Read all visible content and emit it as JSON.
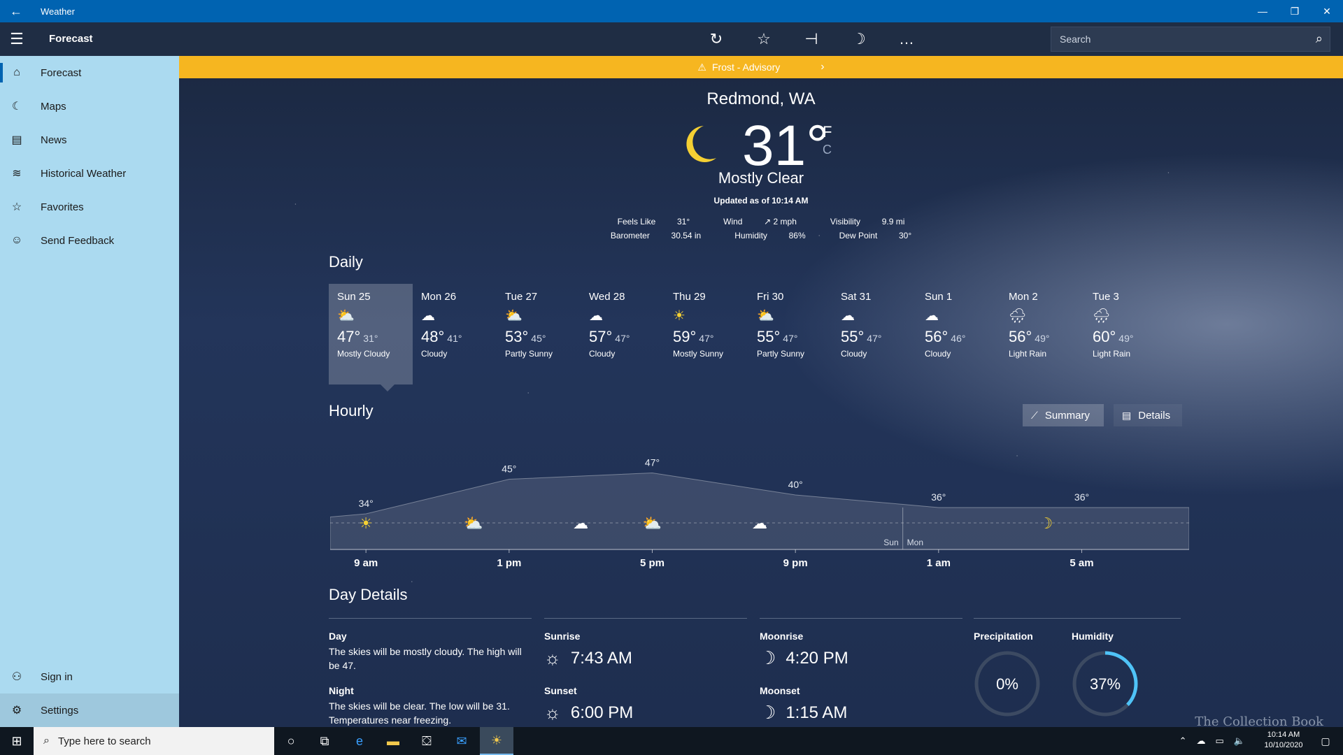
{
  "window": {
    "title": "Weather",
    "back": "←",
    "minimize": "—",
    "restore": "❐",
    "close": "✕"
  },
  "header": {
    "page_title": "Forecast",
    "search_placeholder": "Search"
  },
  "sidebar": {
    "items": [
      {
        "label": "Forecast",
        "icon": "⌂"
      },
      {
        "label": "Maps",
        "icon": "☾"
      },
      {
        "label": "News",
        "icon": "▤"
      },
      {
        "label": "Historical Weather",
        "icon": "≋"
      },
      {
        "label": "Favorites",
        "icon": "☆"
      },
      {
        "label": "Send Feedback",
        "icon": "☺"
      }
    ],
    "bottom": [
      {
        "label": "Sign in",
        "icon": "⚇"
      },
      {
        "label": "Settings",
        "icon": "⚙"
      }
    ]
  },
  "advisory": {
    "text": "Frost - Advisory"
  },
  "current": {
    "city": "Redmond, WA",
    "temp": "31°",
    "unit_f": "F",
    "unit_c": "C",
    "condition": "Mostly Clear",
    "updated": "Updated as of 10:14 AM",
    "feels_like_label": "Feels Like",
    "feels_like": "31°",
    "wind_label": "Wind",
    "wind": "↗ 2 mph",
    "visibility_label": "Visibility",
    "visibility": "9.9 mi",
    "barometer_label": "Barometer",
    "barometer": "30.54 in",
    "humidity_label": "Humidity",
    "humidity": "86%",
    "dewpoint_label": "Dew Point",
    "dewpoint": "30°"
  },
  "daily": {
    "title": "Daily",
    "days": [
      {
        "name": "Sun 25",
        "high": "47°",
        "low": "31°",
        "cond": "Mostly Cloudy",
        "icon": "partly"
      },
      {
        "name": "Mon 26",
        "high": "48°",
        "low": "41°",
        "cond": "Cloudy",
        "icon": "cloud"
      },
      {
        "name": "Tue 27",
        "high": "53°",
        "low": "45°",
        "cond": "Partly Sunny",
        "icon": "partly"
      },
      {
        "name": "Wed 28",
        "high": "57°",
        "low": "47°",
        "cond": "Cloudy",
        "icon": "cloud"
      },
      {
        "name": "Thu 29",
        "high": "59°",
        "low": "47°",
        "cond": "Mostly Sunny",
        "icon": "sun"
      },
      {
        "name": "Fri 30",
        "high": "55°",
        "low": "47°",
        "cond": "Partly Sunny",
        "icon": "partly"
      },
      {
        "name": "Sat 31",
        "high": "55°",
        "low": "47°",
        "cond": "Cloudy",
        "icon": "cloud"
      },
      {
        "name": "Sun 1",
        "high": "56°",
        "low": "46°",
        "cond": "Cloudy",
        "icon": "cloud"
      },
      {
        "name": "Mon 2",
        "high": "56°",
        "low": "49°",
        "cond": "Light Rain",
        "icon": "rain"
      },
      {
        "name": "Tue 3",
        "high": "60°",
        "low": "49°",
        "cond": "Light Rain",
        "icon": "rain"
      }
    ]
  },
  "hourly": {
    "title": "Hourly",
    "summary_label": "Summary",
    "details_label": "Details",
    "time_labels": [
      "9 am",
      "1 pm",
      "5 pm",
      "9 pm",
      "1 am",
      "5 am"
    ],
    "temps": [
      {
        "hour": 9,
        "temp": "34°",
        "v": 34
      },
      {
        "hour": 13,
        "temp": "45°",
        "v": 45
      },
      {
        "hour": 17,
        "temp": "47°",
        "v": 47
      },
      {
        "hour": 21,
        "temp": "40°",
        "v": 40
      },
      {
        "hour": 25,
        "temp": "36°",
        "v": 36
      },
      {
        "hour": 29,
        "temp": "36°",
        "v": 36
      }
    ],
    "day_split_left": "Sun",
    "day_split_right": "Mon",
    "icons": [
      {
        "hour": 9,
        "icon": "sun"
      },
      {
        "hour": 12,
        "icon": "partly"
      },
      {
        "hour": 15,
        "icon": "cloud"
      },
      {
        "hour": 17,
        "icon": "partly"
      },
      {
        "hour": 20,
        "icon": "cloud"
      },
      {
        "hour": 28,
        "icon": "moon"
      }
    ]
  },
  "day_details": {
    "title": "Day Details",
    "day_label": "Day",
    "day_text": "The skies will be mostly cloudy. The high will be 47.",
    "night_label": "Night",
    "night_text": "The skies will be clear. The low will be 31. Temperatures near freezing.",
    "sunrise_label": "Sunrise",
    "sunrise": "7:43 AM",
    "sunset_label": "Sunset",
    "sunset": "6:00 PM",
    "moonrise_label": "Moonrise",
    "moonrise": "4:20 PM",
    "moonset_label": "Moonset",
    "moonset": "1:15 AM",
    "precip_label": "Precipitation",
    "precip": "0%",
    "precip_value": 0,
    "humidity_label": "Humidity",
    "humidity": "37%",
    "humidity_value": 37
  },
  "taskbar": {
    "search_placeholder": "Type here to search",
    "time": "10:14 AM",
    "date": "10/10/2020"
  },
  "watermark": "The Collection Book",
  "colors": {
    "accent": "#0063b1",
    "advisory": "#f6b620",
    "moon": "#f5d033",
    "ring": "#4fc3f7"
  }
}
